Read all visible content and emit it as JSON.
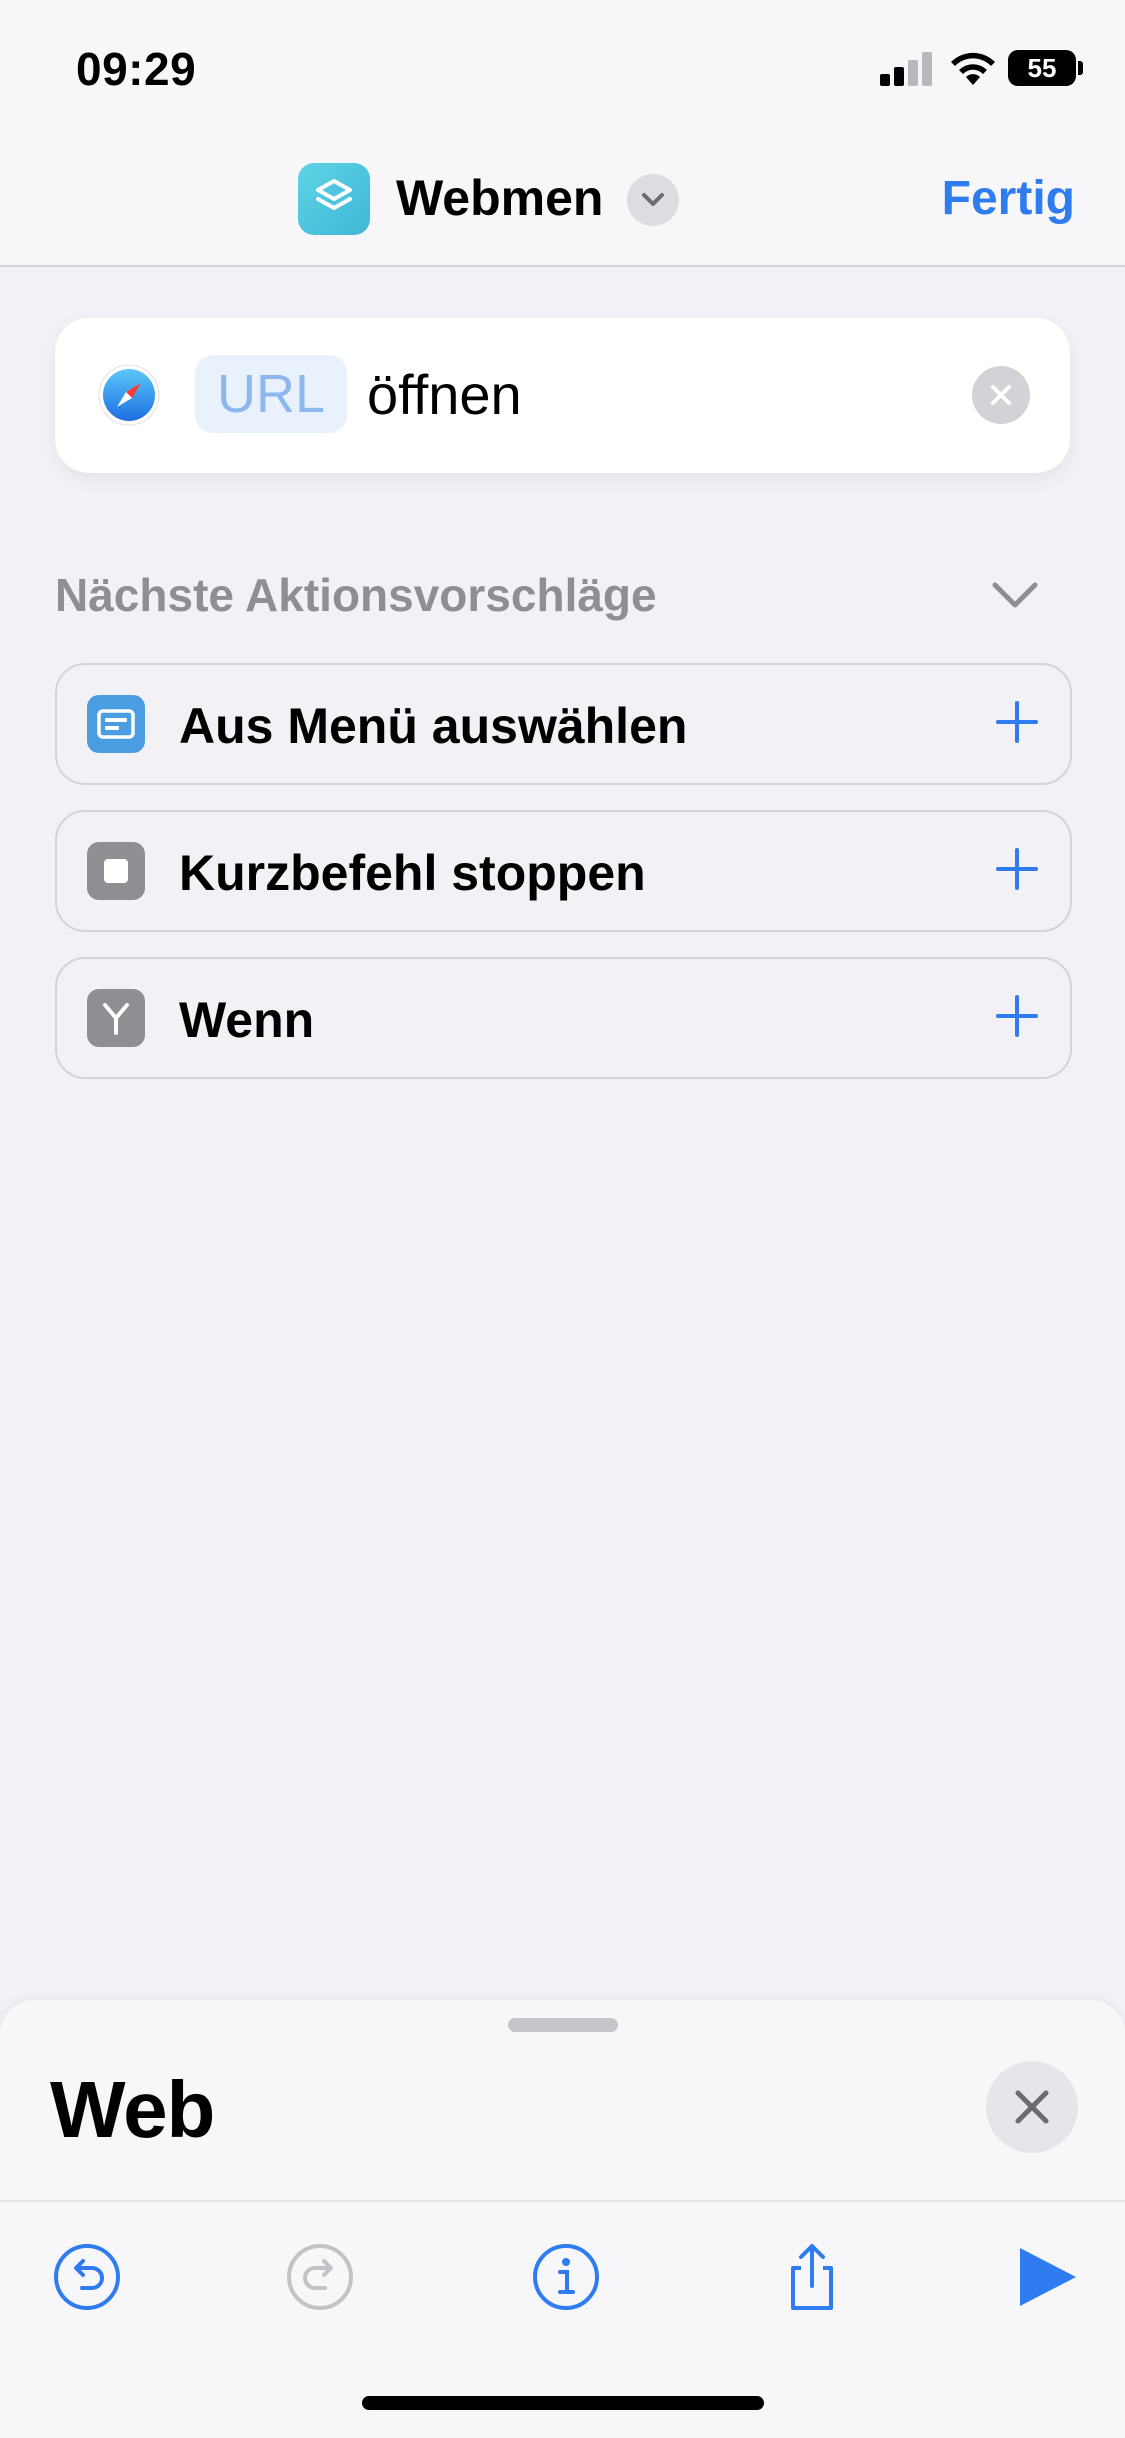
{
  "status_bar": {
    "time": "09:29",
    "battery": "55"
  },
  "nav": {
    "title": "Webmen",
    "done_label": "Fertig"
  },
  "action": {
    "token": "URL",
    "text": "öffnen",
    "icon": "safari-icon"
  },
  "suggestions": {
    "header": "Nächste Aktionsvorschläge",
    "items": [
      {
        "label": "Aus Menü auswählen",
        "icon": "menu-icon",
        "color": "#4a9de0"
      },
      {
        "label": "Kurzbefehl stoppen",
        "icon": "stop-icon",
        "color": "#8e8e93"
      },
      {
        "label": "Wenn",
        "icon": "branch-icon",
        "color": "#8e8e93"
      }
    ]
  },
  "sheet": {
    "title": "Web"
  },
  "toolbar": {
    "items": [
      "undo-icon",
      "redo-icon",
      "info-icon",
      "share-icon",
      "play-icon"
    ]
  },
  "colors": {
    "accent": "#2f7bf0",
    "background": "#f1f1f6"
  }
}
